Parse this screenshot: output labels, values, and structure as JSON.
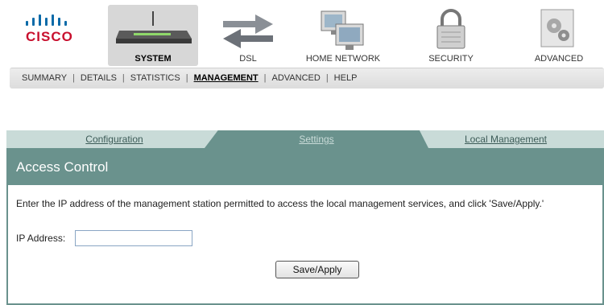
{
  "brand": {
    "logo_text": "CISCO"
  },
  "topnav": {
    "items": [
      {
        "label": "SYSTEM",
        "icon": "router-icon",
        "active": true
      },
      {
        "label": "DSL",
        "icon": "transfer-arrows-icon",
        "active": false
      },
      {
        "label": "HOME NETWORK",
        "icon": "computers-icon",
        "active": false
      },
      {
        "label": "SECURITY",
        "icon": "padlock-icon",
        "active": false
      },
      {
        "label": "ADVANCED",
        "icon": "gears-icon",
        "active": false
      }
    ]
  },
  "subnav": {
    "items": [
      {
        "label": "SUMMARY"
      },
      {
        "label": "DETAILS"
      },
      {
        "label": "STATISTICS"
      },
      {
        "label": "MANAGEMENT",
        "active": true
      },
      {
        "label": "ADVANCED"
      },
      {
        "label": "HELP"
      }
    ]
  },
  "tabs": [
    {
      "label": "Configuration"
    },
    {
      "label": "Settings",
      "active": true
    },
    {
      "label": "Local Management"
    }
  ],
  "panel": {
    "title": "Access Control",
    "instructions": "Enter the IP address of the management station permitted to access the local management services, and click 'Save/Apply.'",
    "ip_label": "IP Address:",
    "ip_value": "",
    "save_label": "Save/Apply"
  },
  "colors": {
    "accent": "#6a928d",
    "tab_light": "#c9dbd8",
    "cisco_red": "#c8102e",
    "cisco_blue": "#0a6aa8"
  }
}
